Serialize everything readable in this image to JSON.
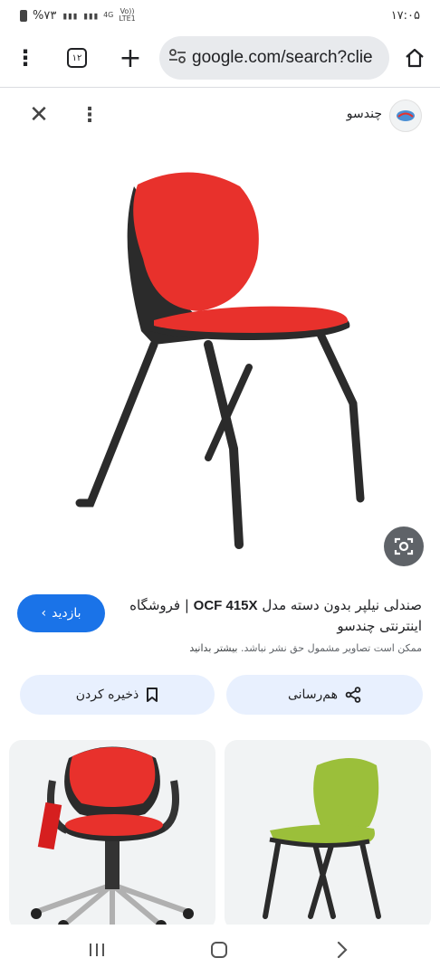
{
  "status_bar": {
    "battery": "%۷۳",
    "net_top": "4G",
    "net_bottom": "LTE1",
    "volte_top": "Vo))",
    "volte_bottom": "",
    "time": "۱۷:۰۵"
  },
  "browser": {
    "tab_count": "۱۲",
    "url": "google.com/search?clie"
  },
  "viewer": {
    "site_name": "چندسو",
    "title_prefix": "صندلی نیلپر بدون دسته مدل ",
    "title_model": "OCF 415X",
    "title_suffix": " | فروشگاه اینترنتی چندسو",
    "notice_text": "ممکن است تصاویر مشمول حق نشر نباشد. ",
    "notice_link": "بیشتر بدانید",
    "visit_label": "بازدید",
    "share_label": "هم‌رسانی",
    "save_label": "ذخیره کردن"
  },
  "colors": {
    "accent": "#1a73e8",
    "chair_red": "#e8312c",
    "chair_green": "#9bbf3a",
    "chair_frame": "#2b2b2b"
  },
  "icons": {
    "menu": "more-vert-icon",
    "tabs": "tab-switcher-icon",
    "new_tab": "plus-icon",
    "site_settings": "tune-icon",
    "home": "home-icon",
    "close": "close-icon",
    "more": "more-vert-icon",
    "lens": "google-lens-icon",
    "share": "share-icon",
    "save": "bookmark-icon"
  }
}
